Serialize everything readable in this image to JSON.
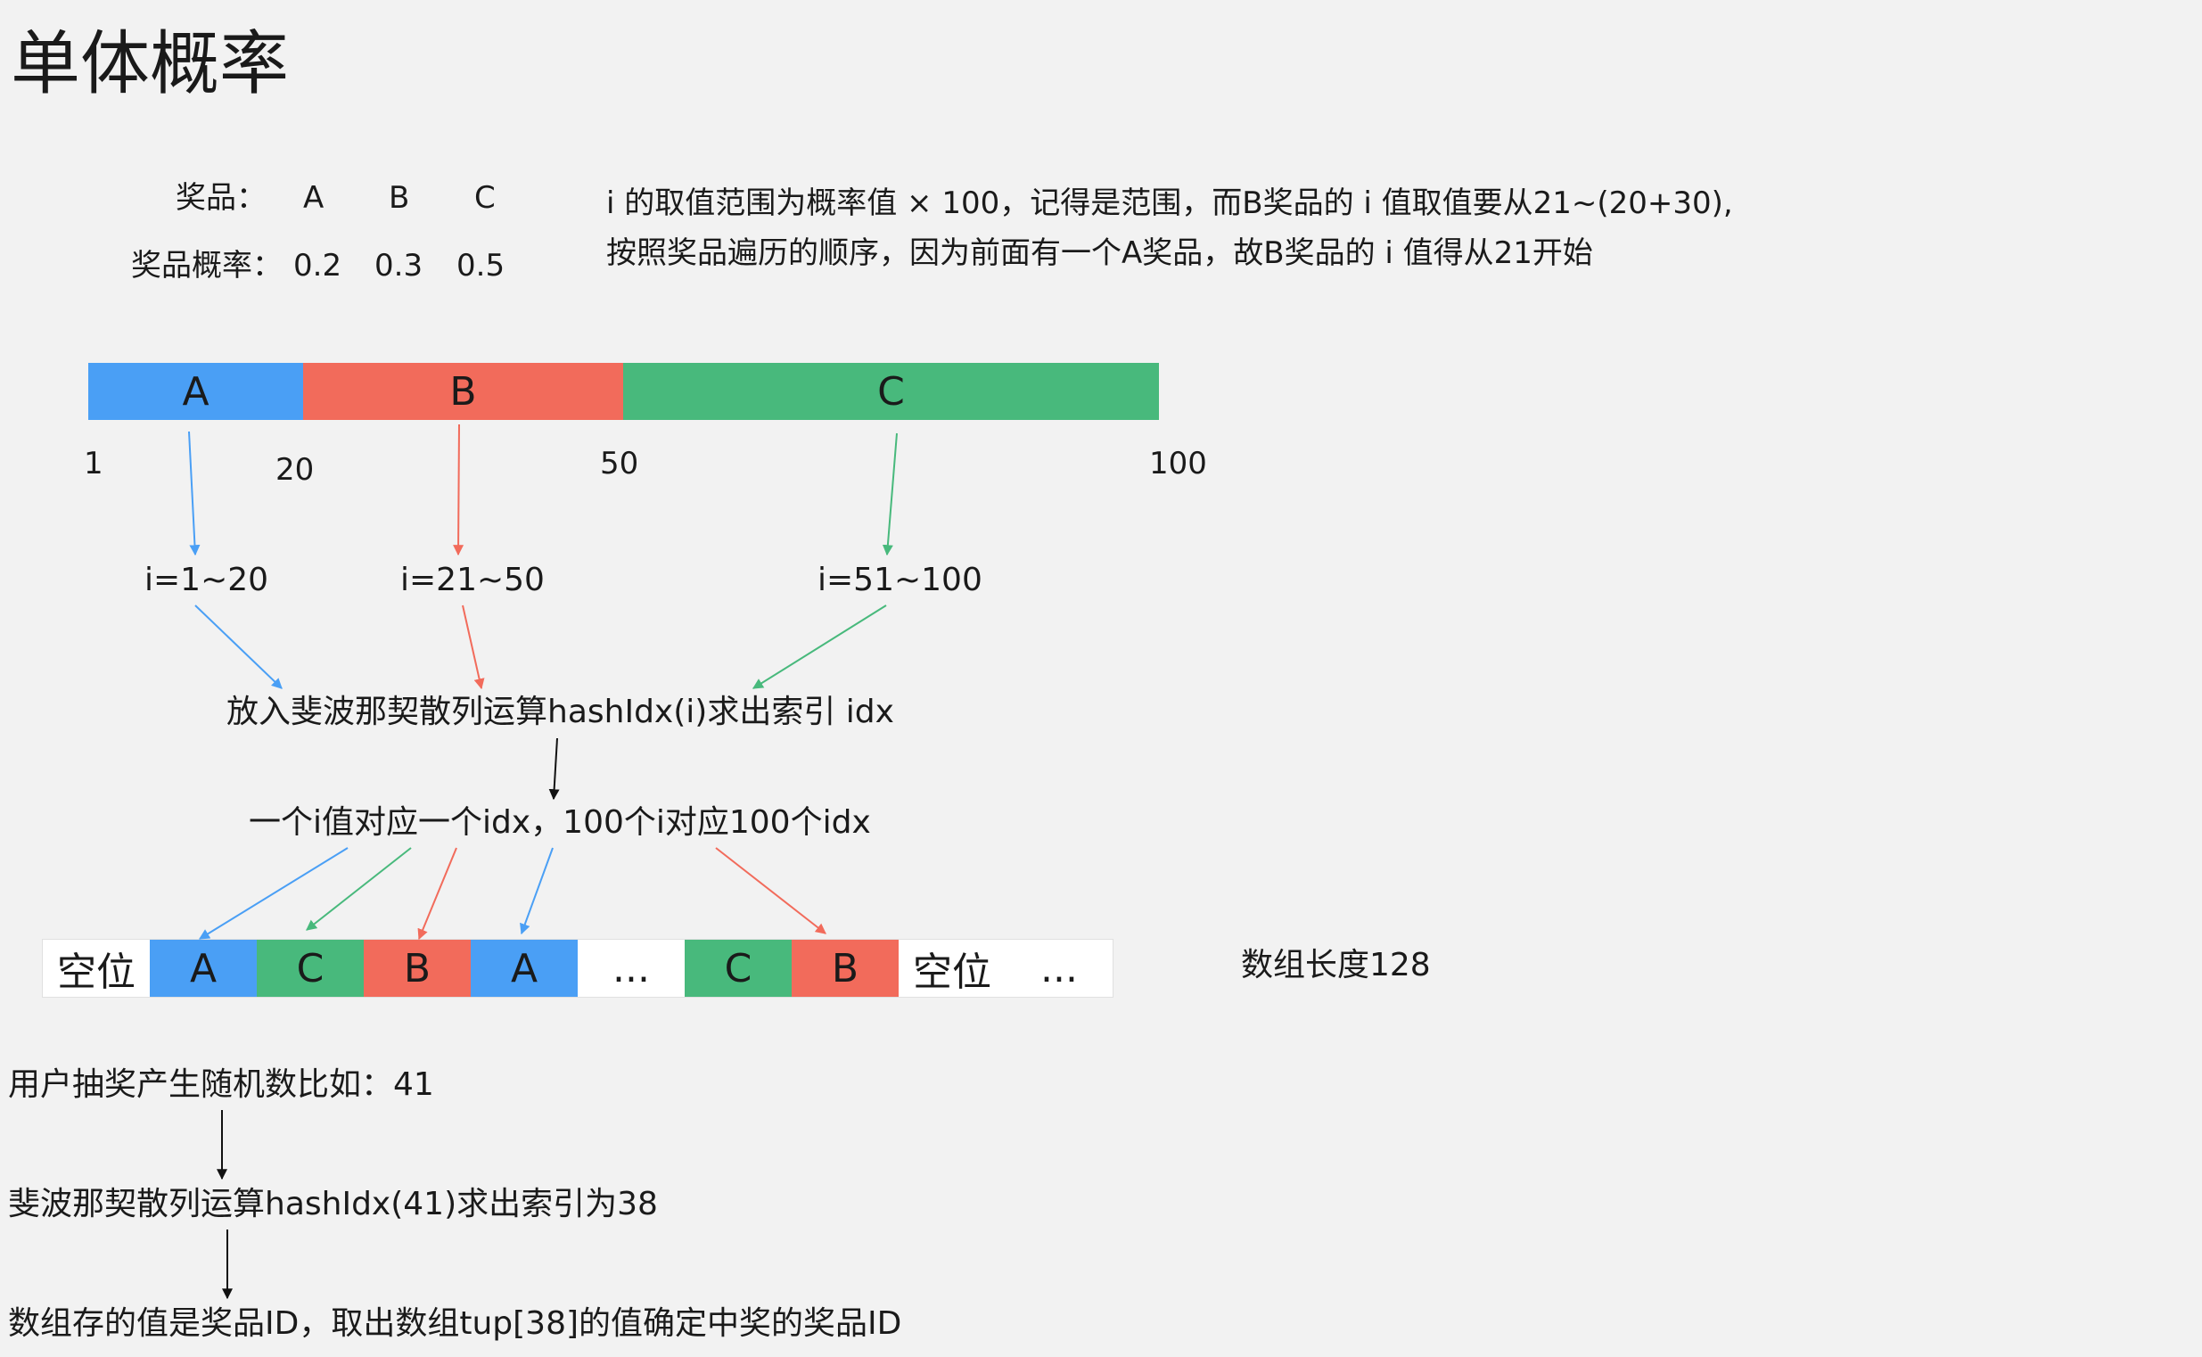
{
  "title": "单体概率",
  "prizes": {
    "label": "奖品：",
    "names": [
      "A",
      "B",
      "C"
    ],
    "prob_label": "奖品概率：",
    "probs": [
      "0.2",
      "0.3",
      "0.5"
    ]
  },
  "note": {
    "line1": "i 的取值范围为概率值 × 100，记得是范围，而B奖品的 i 值取值要从21~(20+30),",
    "line2": "按照奖品遍历的顺序，因为前面有一个A奖品，故B奖品的 i 值得从21开始"
  },
  "bar": {
    "segments": [
      "A",
      "B",
      "C"
    ],
    "ticks": [
      "1",
      "20",
      "50",
      "100"
    ]
  },
  "ranges": [
    "i=1~20",
    "i=21~50",
    "i=51~100"
  ],
  "hash_step": "放入斐波那契散列运算hashIdx(i)求出索引 idx",
  "mapping_step": "一个i值对应一个idx，100个i对应100个idx",
  "array": {
    "cells": [
      "空位",
      "A",
      "C",
      "B",
      "A",
      "...",
      "C",
      "B",
      "空位",
      "..."
    ],
    "length_label": "数组长度128"
  },
  "flow": {
    "step1": "用户抽奖产生随机数比如：41",
    "step2": "斐波那契散列运算hashIdx(41)求出索引为38",
    "step3": "数组存的值是奖品ID，取出数组tup[38]的值确定中奖的奖品ID"
  },
  "colors": {
    "a": "#4a9ff5",
    "b": "#f26b5b",
    "c": "#48b97c",
    "background": "#f2f2f2"
  }
}
